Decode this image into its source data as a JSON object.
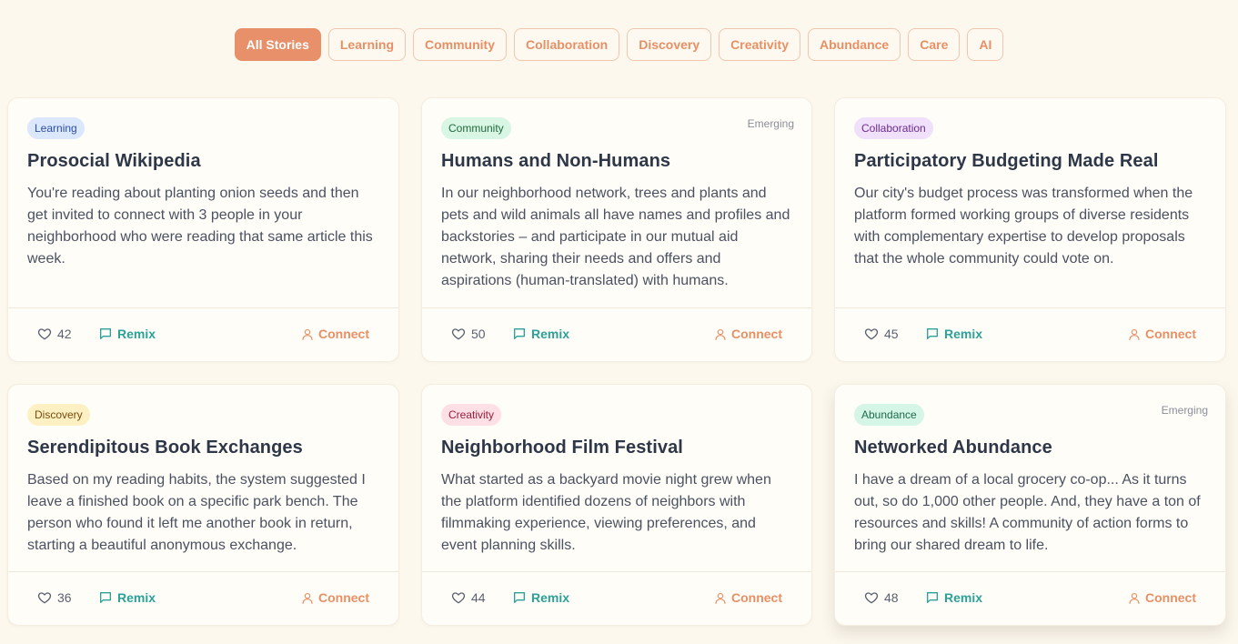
{
  "filters": [
    "All Stories",
    "Learning",
    "Community",
    "Collaboration",
    "Discovery",
    "Creativity",
    "Abundance",
    "Care",
    "AI"
  ],
  "active_filter": "All Stories",
  "colors": {
    "background": "#fcf8ee",
    "accent_orange": "#e8906a",
    "accent_teal": "#2ba198"
  },
  "cards": [
    {
      "tag": "Learning",
      "tag_bg": "#dbe7fd",
      "tag_fg": "#2c4fa3",
      "emerging": "",
      "title": "Prosocial Wikipedia",
      "body": "You're reading about planting onion seeds and then get invited to connect with 3 people in your neighborhood who were reading that same article this week.",
      "likes": "42",
      "remix": "Remix",
      "connect": "Connect"
    },
    {
      "tag": "Community",
      "tag_bg": "#d9f5e3",
      "tag_fg": "#1f6b3e",
      "emerging": "Emerging",
      "title": "Humans and Non-Humans",
      "body": "In our neighborhood network, trees and plants and pets and wild animals all have names and profiles and backstories – and participate in our mutual aid network, sharing their needs and offers and aspirations (human-translated) with humans.",
      "likes": "50",
      "remix": "Remix",
      "connect": "Connect"
    },
    {
      "tag": "Collaboration",
      "tag_bg": "#f0e0fb",
      "tag_fg": "#6b2c8f",
      "emerging": "",
      "title": "Participatory Budgeting Made Real",
      "body": "Our city's budget process was transformed when the platform formed working groups of diverse residents with complementary expertise to develop proposals that the whole community could vote on.",
      "likes": "45",
      "remix": "Remix",
      "connect": "Connect"
    },
    {
      "tag": "Discovery",
      "tag_bg": "#fdf0c2",
      "tag_fg": "#7a4b0c",
      "emerging": "",
      "title": "Serendipitous Book Exchanges",
      "body": "Based on my reading habits, the system suggested I leave a finished book on a specific park bench. The person who found it left me another book in return, starting a beautiful anonymous exchange.",
      "likes": "36",
      "remix": "Remix",
      "connect": "Connect"
    },
    {
      "tag": "Creativity",
      "tag_bg": "#fde0e6",
      "tag_fg": "#9b1c3a",
      "emerging": "",
      "title": "Neighborhood Film Festival",
      "body": "What started as a backyard movie night grew when the platform identified dozens of neighbors with filmmaking experience, viewing preferences, and event planning skills.",
      "likes": "44",
      "remix": "Remix",
      "connect": "Connect"
    },
    {
      "tag": "Abundance",
      "tag_bg": "#d5f5e6",
      "tag_fg": "#1d6b4c",
      "emerging": "Emerging",
      "title": "Networked Abundance",
      "body": "I have a dream of a local grocery co-op... As it turns out, so do 1,000 other people. And, they have a ton of resources and skills! A community of action forms to bring our shared dream to life.",
      "likes": "48",
      "remix": "Remix",
      "connect": "Connect"
    }
  ]
}
